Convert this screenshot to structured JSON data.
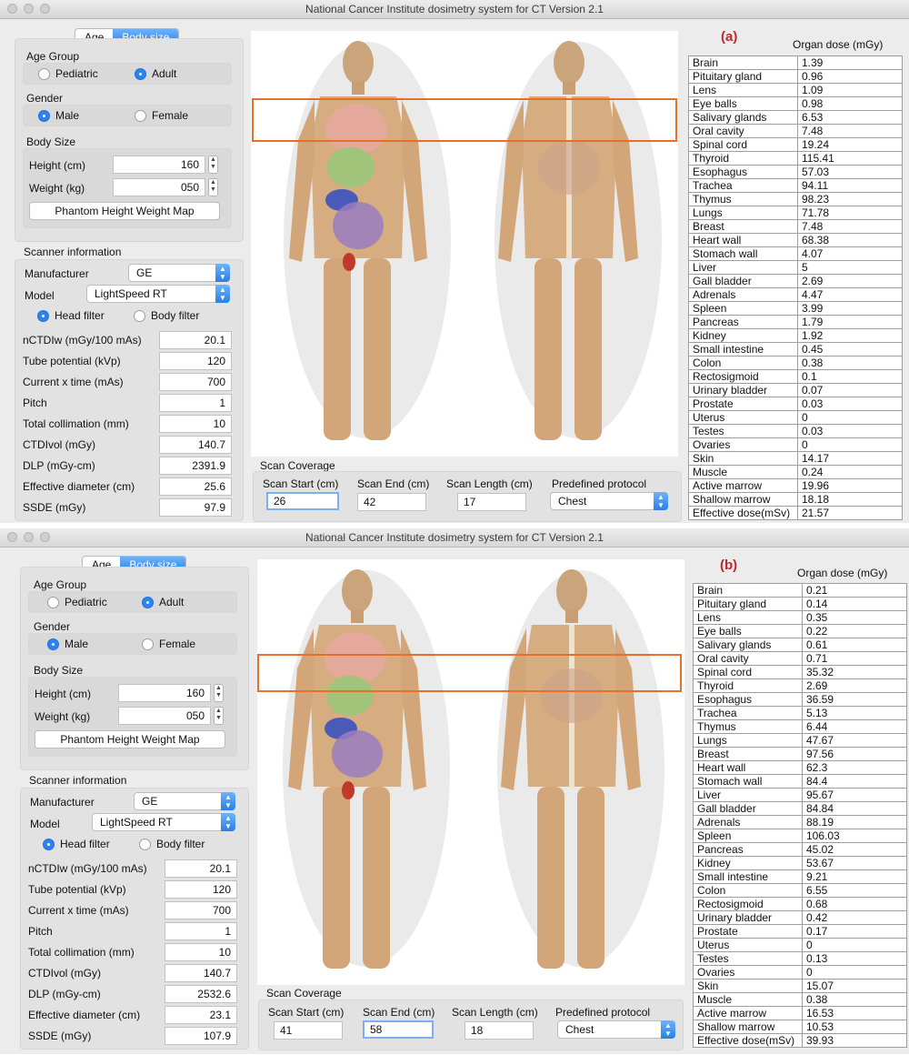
{
  "window_title": "National Cancer Institute dosimetry system for CT Version 2.1",
  "panels": [
    {
      "tag": "(a)",
      "tabs": [
        "Age",
        "Body size"
      ],
      "active_tab": "Body size",
      "age_group": {
        "label": "Age Group",
        "options": [
          "Pediatric",
          "Adult"
        ],
        "selected": "Adult"
      },
      "gender": {
        "label": "Gender",
        "options": [
          "Male",
          "Female"
        ],
        "selected": "Male"
      },
      "body_size": {
        "label": "Body Size",
        "height_label": "Height (cm)",
        "height": "160",
        "weight_label": "Weight (kg)",
        "weight": "050",
        "map_button": "Phantom Height Weight Map"
      },
      "scanner": {
        "label": "Scanner information",
        "manufacturer_label": "Manufacturer",
        "manufacturer": "GE",
        "model_label": "Model",
        "model": "LightSpeed RT",
        "filters": [
          "Head filter",
          "Body filter"
        ],
        "filter_selected": "Head filter",
        "params": [
          {
            "label": "nCTDIw (mGy/100 mAs)",
            "value": "20.1"
          },
          {
            "label": "Tube potential (kVp)",
            "value": "120"
          },
          {
            "label": "Current x time (mAs)",
            "value": "700"
          },
          {
            "label": "Pitch",
            "value": "1"
          },
          {
            "label": "Total collimation (mm)",
            "value": "10"
          },
          {
            "label": "CTDIvol (mGy)",
            "value": "140.7"
          },
          {
            "label": "DLP (mGy-cm)",
            "value": "2391.9"
          },
          {
            "label": "Effective diameter (cm)",
            "value": "25.6"
          },
          {
            "label": "SSDE (mGy)",
            "value": "97.9"
          }
        ]
      },
      "scan_coverage": {
        "label": "Scan Coverage",
        "start_label": "Scan Start (cm)",
        "start": "26",
        "end_label": "Scan End (cm)",
        "end": "42",
        "length_label": "Scan Length (cm)",
        "length": "17",
        "protocol_label": "Predefined protocol",
        "protocol": "Chest",
        "focused": "start"
      },
      "organ_header": "Organ dose (mGy)",
      "organs": [
        [
          "Brain",
          "1.39"
        ],
        [
          "Pituitary gland",
          "0.96"
        ],
        [
          "Lens",
          "1.09"
        ],
        [
          "Eye balls",
          "0.98"
        ],
        [
          "Salivary glands",
          "6.53"
        ],
        [
          "Oral cavity",
          "7.48"
        ],
        [
          "Spinal cord",
          "19.24"
        ],
        [
          "Thyroid",
          "115.41"
        ],
        [
          "Esophagus",
          "57.03"
        ],
        [
          "Trachea",
          "94.11"
        ],
        [
          "Thymus",
          "98.23"
        ],
        [
          "Lungs",
          "71.78"
        ],
        [
          "Breast",
          "7.48"
        ],
        [
          "Heart wall",
          "68.38"
        ],
        [
          "Stomach wall",
          "4.07"
        ],
        [
          "Liver",
          "5"
        ],
        [
          "Gall bladder",
          "2.69"
        ],
        [
          "Adrenals",
          "4.47"
        ],
        [
          "Spleen",
          "3.99"
        ],
        [
          "Pancreas",
          "1.79"
        ],
        [
          "Kidney",
          "1.92"
        ],
        [
          "Small intestine",
          "0.45"
        ],
        [
          "Colon",
          "0.38"
        ],
        [
          "Rectosigmoid",
          "0.1"
        ],
        [
          "Urinary bladder",
          "0.07"
        ],
        [
          "Prostate",
          "0.03"
        ],
        [
          "Uterus",
          "0"
        ],
        [
          "Testes",
          "0.03"
        ],
        [
          "Ovaries",
          "0"
        ],
        [
          "Skin",
          "14.17"
        ],
        [
          "Muscle",
          "0.24"
        ],
        [
          "Active marrow",
          "19.96"
        ],
        [
          "Shallow marrow",
          "18.18"
        ],
        [
          "Effective dose(mSv)",
          "21.57"
        ]
      ]
    },
    {
      "tag": "(b)",
      "tabs": [
        "Age",
        "Body size"
      ],
      "active_tab": "Body size",
      "age_group": {
        "label": "Age Group",
        "options": [
          "Pediatric",
          "Adult"
        ],
        "selected": "Adult"
      },
      "gender": {
        "label": "Gender",
        "options": [
          "Male",
          "Female"
        ],
        "selected": "Male"
      },
      "body_size": {
        "label": "Body Size",
        "height_label": "Height (cm)",
        "height": "160",
        "weight_label": "Weight (kg)",
        "weight": "050",
        "map_button": "Phantom Height Weight Map"
      },
      "scanner": {
        "label": "Scanner information",
        "manufacturer_label": "Manufacturer",
        "manufacturer": "GE",
        "model_label": "Model",
        "model": "LightSpeed RT",
        "filters": [
          "Head filter",
          "Body filter"
        ],
        "filter_selected": "Head filter",
        "params": [
          {
            "label": "nCTDIw (mGy/100 mAs)",
            "value": "20.1"
          },
          {
            "label": "Tube potential (kVp)",
            "value": "120"
          },
          {
            "label": "Current x time (mAs)",
            "value": "700"
          },
          {
            "label": "Pitch",
            "value": "1"
          },
          {
            "label": "Total collimation (mm)",
            "value": "10"
          },
          {
            "label": "CTDIvol (mGy)",
            "value": "140.7"
          },
          {
            "label": "DLP (mGy-cm)",
            "value": "2532.6"
          },
          {
            "label": "Effective diameter (cm)",
            "value": "23.1"
          },
          {
            "label": "SSDE (mGy)",
            "value": "107.9"
          }
        ]
      },
      "scan_coverage": {
        "label": "Scan Coverage",
        "start_label": "Scan Start (cm)",
        "start": "41",
        "end_label": "Scan End (cm)",
        "end": "58",
        "length_label": "Scan Length (cm)",
        "length": "18",
        "protocol_label": "Predefined protocol",
        "protocol": "Chest",
        "focused": "end"
      },
      "organ_header": "Organ dose (mGy)",
      "organs": [
        [
          "Brain",
          "0.21"
        ],
        [
          "Pituitary gland",
          "0.14"
        ],
        [
          "Lens",
          "0.35"
        ],
        [
          "Eye balls",
          "0.22"
        ],
        [
          "Salivary glands",
          "0.61"
        ],
        [
          "Oral cavity",
          "0.71"
        ],
        [
          "Spinal cord",
          "35.32"
        ],
        [
          "Thyroid",
          "2.69"
        ],
        [
          "Esophagus",
          "36.59"
        ],
        [
          "Trachea",
          "5.13"
        ],
        [
          "Thymus",
          "6.44"
        ],
        [
          "Lungs",
          "47.67"
        ],
        [
          "Breast",
          "97.56"
        ],
        [
          "Heart wall",
          "62.3"
        ],
        [
          "Stomach wall",
          "84.4"
        ],
        [
          "Liver",
          "95.67"
        ],
        [
          "Gall bladder",
          "84.84"
        ],
        [
          "Adrenals",
          "88.19"
        ],
        [
          "Spleen",
          "106.03"
        ],
        [
          "Pancreas",
          "45.02"
        ],
        [
          "Kidney",
          "53.67"
        ],
        [
          "Small intestine",
          "9.21"
        ],
        [
          "Colon",
          "6.55"
        ],
        [
          "Rectosigmoid",
          "0.68"
        ],
        [
          "Urinary bladder",
          "0.42"
        ],
        [
          "Prostate",
          "0.17"
        ],
        [
          "Uterus",
          "0"
        ],
        [
          "Testes",
          "0.13"
        ],
        [
          "Ovaries",
          "0"
        ],
        [
          "Skin",
          "15.07"
        ],
        [
          "Muscle",
          "0.38"
        ],
        [
          "Active marrow",
          "16.53"
        ],
        [
          "Shallow marrow",
          "10.53"
        ],
        [
          "Effective dose(mSv)",
          "39.93"
        ]
      ]
    }
  ]
}
